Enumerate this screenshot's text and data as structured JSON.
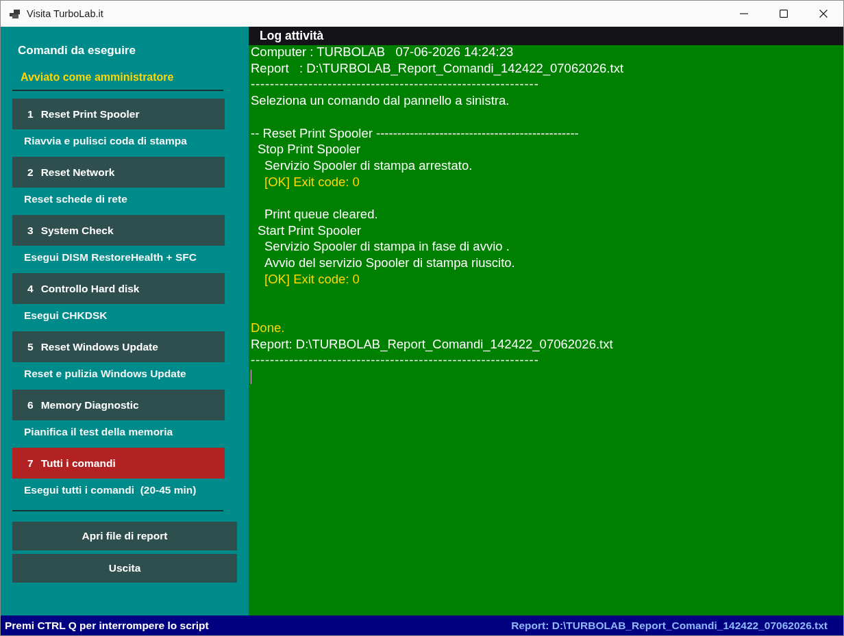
{
  "window": {
    "title": "Visita TurboLab.it"
  },
  "sidebar": {
    "title": "Comandi da eseguire",
    "status": "Avviato come amministratore",
    "commands": [
      {
        "number": "1",
        "label": "Reset Print Spooler",
        "description": "Riavvia e pulisci coda di stampa",
        "kind": "standard"
      },
      {
        "number": "2",
        "label": "Reset Network",
        "description": "Reset schede di rete",
        "kind": "standard"
      },
      {
        "number": "3",
        "label": "System Check",
        "description": "Esegui DISM RestoreHealth + SFC",
        "kind": "standard"
      },
      {
        "number": "4",
        "label": "Controllo Hard disk",
        "description": "Esegui CHKDSK",
        "kind": "standard"
      },
      {
        "number": "5",
        "label": "Reset Windows Update",
        "description": "Reset e pulizia Windows Update",
        "kind": "standard"
      },
      {
        "number": "6",
        "label": "Memory Diagnostic",
        "description": "Pianifica il test della memoria",
        "kind": "standard"
      },
      {
        "number": "7",
        "label": "Tutti i comandi",
        "description": "Esegui tutti i comandi  (20-45 min)",
        "kind": "highlight"
      }
    ],
    "actions": [
      "Apri file di report",
      "Uscita"
    ]
  },
  "log": {
    "title": "Log attività",
    "lines": [
      {
        "text": "Computer : TURBOLAB   07-06-2026 14:24:23",
        "kind": "text"
      },
      {
        "text": "Report   : D:\\TURBOLAB_Report_Comandi_142422_07062026.txt",
        "kind": "text"
      },
      {
        "text": "------------------------------------------------------------",
        "kind": "rule"
      },
      {
        "text": "Seleziona un comando dal pannello a sinistra.",
        "kind": "text"
      },
      {
        "kind": "blank"
      },
      {
        "text": "-- Reset Print Spooler ------------------------------------------------",
        "kind": "text",
        "children": [
          {
            "text": "Stop Print Spooler",
            "kind": "text",
            "children": [
              {
                "text": "Servizio Spooler di stampa arrestato.",
                "kind": "text"
              },
              {
                "text": "[OK] Exit code: 0",
                "kind": "success"
              },
              {
                "kind": "blank"
              },
              {
                "text": "Print queue cleared.",
                "kind": "text"
              }
            ]
          },
          {
            "text": "Start Print Spooler",
            "kind": "text",
            "children": [
              {
                "text": "Servizio Spooler di stampa in fase di avvio .",
                "kind": "text"
              },
              {
                "text": "Avvio del servizio Spooler di stampa riuscito.",
                "kind": "text"
              },
              {
                "text": "[OK] Exit code: 0",
                "kind": "success"
              }
            ]
          }
        ]
      },
      {
        "kind": "blank"
      },
      {
        "kind": "blank"
      },
      {
        "text": "Done.",
        "kind": "success"
      },
      {
        "text": "Report: D:\\TURBOLAB_Report_Comandi_142422_07062026.txt",
        "kind": "text"
      },
      {
        "text": "------------------------------------------------------------",
        "kind": "rule"
      }
    ]
  },
  "status_bar": {
    "hint": "Premi CTRL Q per interrompere lo script",
    "report": "Report: D:\\TURBOLAB_Report_Comandi_142422_07062026.txt"
  }
}
